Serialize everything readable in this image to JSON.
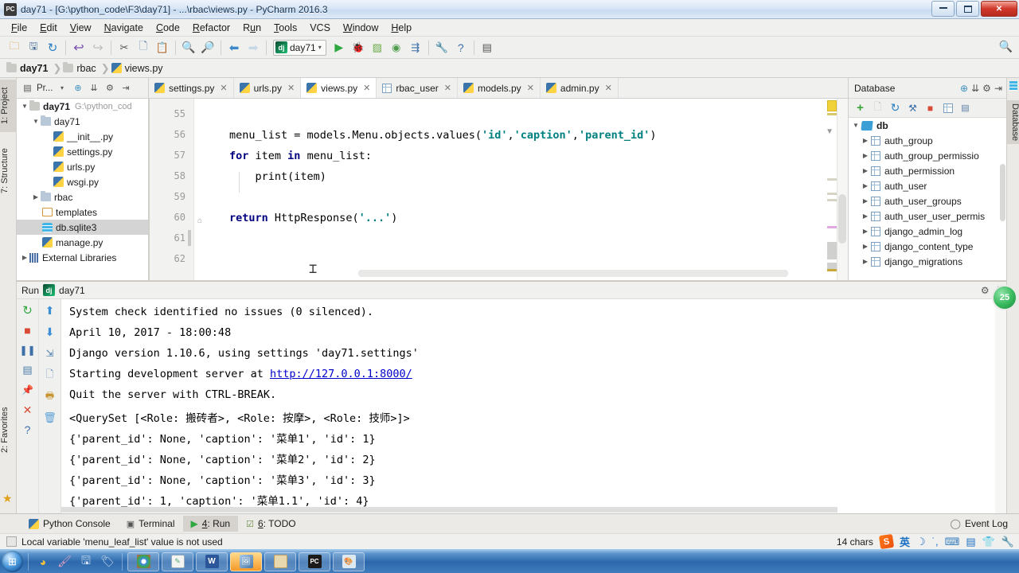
{
  "window": {
    "title": "day71 - [G:\\python_code\\F3\\day71] - ...\\rbac\\views.py - PyCharm 2016.3",
    "app_icon": "pycharm-icon",
    "minimize": "minimize-icon",
    "maximize": "restore-icon",
    "close": "✕"
  },
  "menubar": [
    {
      "label": "File"
    },
    {
      "label": "Edit"
    },
    {
      "label": "View"
    },
    {
      "label": "Navigate"
    },
    {
      "label": "Code"
    },
    {
      "label": "Refactor"
    },
    {
      "label": "Run"
    },
    {
      "label": "Tools"
    },
    {
      "label": "VCS"
    },
    {
      "label": "Window"
    },
    {
      "label": "Help"
    }
  ],
  "toolbar": {
    "buttons": [
      {
        "name": "open-folder-icon",
        "glyph": "🗀"
      },
      {
        "name": "save-all-icon",
        "glyph": "🖫"
      },
      {
        "name": "sync-icon",
        "glyph": "↻"
      },
      {
        "name": "undo-icon",
        "glyph": "↩"
      },
      {
        "name": "redo-icon",
        "glyph": "↪"
      },
      {
        "name": "cut-icon",
        "glyph": "✂"
      },
      {
        "name": "copy-icon",
        "glyph": "🗋"
      },
      {
        "name": "paste-icon",
        "glyph": "📋"
      },
      {
        "name": "find-icon",
        "glyph": "🔍"
      },
      {
        "name": "replace-icon",
        "glyph": "🔎"
      },
      {
        "name": "back-icon",
        "glyph": "⬅"
      },
      {
        "name": "forward-icon",
        "glyph": "➡"
      }
    ],
    "run_config": {
      "label": "day71",
      "icon": "django-icon",
      "caret": "▾"
    },
    "run_buttons": [
      {
        "name": "run-icon",
        "glyph": "▶"
      },
      {
        "name": "debug-icon",
        "glyph": "🐞"
      },
      {
        "name": "coverage-icon",
        "glyph": "▨"
      },
      {
        "name": "profile-icon",
        "glyph": "◉"
      },
      {
        "name": "run-with-console-icon",
        "glyph": "⇶"
      },
      {
        "name": "settings-wrench-icon",
        "glyph": "🔧"
      },
      {
        "name": "help-icon",
        "glyph": "?"
      },
      {
        "name": "update-app-icon",
        "glyph": "▤"
      }
    ],
    "search_icon": "search-icon"
  },
  "breadcrumb": [
    {
      "label": "day71",
      "icon": "folder-icon",
      "bold": true
    },
    {
      "label": "rbac",
      "icon": "folder-icon",
      "bold": false
    },
    {
      "label": "views.py",
      "icon": "python-file-icon",
      "bold": false
    }
  ],
  "left_strip": [
    {
      "label": "1: Project",
      "selected": true
    },
    {
      "label": "7: Structure",
      "selected": false
    }
  ],
  "favorites_tab": {
    "label": "2: Favorites",
    "icon": "star-icon"
  },
  "project_panel": {
    "title": "Pr...",
    "toolbar_icons": [
      "target-icon",
      "collapse-all-icon",
      "gear-icon",
      "hide-icon"
    ],
    "tree": [
      {
        "depth": 0,
        "arrow": "▼",
        "label": "day71",
        "path": "G:\\python_cod",
        "icon": "folder-icon",
        "bold": true,
        "selected": false
      },
      {
        "depth": 1,
        "arrow": "▼",
        "label": "day71",
        "path": "",
        "icon": "module-icon",
        "bold": false,
        "selected": false
      },
      {
        "depth": 2,
        "arrow": "",
        "label": "__init__.py",
        "path": "",
        "icon": "python-file-icon",
        "bold": false,
        "selected": false
      },
      {
        "depth": 2,
        "arrow": "",
        "label": "settings.py",
        "path": "",
        "icon": "python-file-icon",
        "bold": false,
        "selected": false
      },
      {
        "depth": 2,
        "arrow": "",
        "label": "urls.py",
        "path": "",
        "icon": "python-file-icon",
        "bold": false,
        "selected": false
      },
      {
        "depth": 2,
        "arrow": "",
        "label": "wsgi.py",
        "path": "",
        "icon": "python-file-icon",
        "bold": false,
        "selected": false
      },
      {
        "depth": 1,
        "arrow": "▶",
        "label": "rbac",
        "path": "",
        "icon": "module-icon",
        "bold": false,
        "selected": false
      },
      {
        "depth": 1,
        "arrow": "",
        "label": "templates",
        "path": "",
        "icon": "templates-folder-icon",
        "bold": false,
        "selected": false
      },
      {
        "depth": 1,
        "arrow": "",
        "label": "db.sqlite3",
        "path": "",
        "icon": "database-file-icon",
        "bold": false,
        "selected": true
      },
      {
        "depth": 1,
        "arrow": "",
        "label": "manage.py",
        "path": "",
        "icon": "python-file-icon",
        "bold": false,
        "selected": false
      },
      {
        "depth": 0,
        "arrow": "▶",
        "label": "External Libraries",
        "path": "",
        "icon": "library-icon",
        "bold": false,
        "selected": false
      }
    ]
  },
  "editor_tabs": [
    {
      "label": "settings.py",
      "icon": "python-file-icon",
      "active": false,
      "close": "✕"
    },
    {
      "label": "urls.py",
      "icon": "python-file-icon",
      "active": false,
      "close": "✕"
    },
    {
      "label": "views.py",
      "icon": "python-file-icon",
      "active": true,
      "close": "✕"
    },
    {
      "label": "rbac_user",
      "icon": "table-icon",
      "active": false,
      "close": "✕"
    },
    {
      "label": "models.py",
      "icon": "python-file-icon",
      "active": false,
      "close": "✕"
    },
    {
      "label": "admin.py",
      "icon": "python-file-icon",
      "active": false,
      "close": "✕"
    }
  ],
  "editor": {
    "line_numbers": [
      "55",
      "56",
      "57",
      "58",
      "59",
      "60",
      "61",
      "62"
    ],
    "lines": [
      {
        "num": "56",
        "tokens": [
          {
            "t": "menu_list = models.Menu.objects.values(",
            "c": "plain"
          },
          {
            "t": "'id'",
            "c": "str"
          },
          {
            "t": ",",
            "c": "plain"
          },
          {
            "t": "'caption'",
            "c": "str"
          },
          {
            "t": ",",
            "c": "plain"
          },
          {
            "t": "'parent_id'",
            "c": "str"
          },
          {
            "t": ")",
            "c": "plain"
          }
        ]
      },
      {
        "num": "57",
        "tokens": [
          {
            "t": "for",
            "c": "kw"
          },
          {
            "t": " item ",
            "c": "plain"
          },
          {
            "t": "in",
            "c": "kw"
          },
          {
            "t": " menu_list:",
            "c": "plain"
          }
        ]
      },
      {
        "num": "58",
        "tokens": [
          {
            "t": "    print(item)",
            "c": "plain"
          }
        ]
      },
      {
        "num": "60",
        "tokens": [
          {
            "t": "return",
            "c": "kw"
          },
          {
            "t": " HttpResponse(",
            "c": "plain"
          },
          {
            "t": "'...'",
            "c": "str"
          },
          {
            "t": ")",
            "c": "plain"
          }
        ]
      }
    ]
  },
  "database_panel": {
    "title": "Database",
    "header_icons": [
      "target-icon",
      "collapse-all-icon",
      "gear-icon",
      "hide-icon"
    ],
    "toolbar_icons": [
      "add-icon",
      "copy-icon",
      "refresh-icon",
      "data-source-icon",
      "stop-icon",
      "table-icon",
      "console-icon"
    ],
    "side_tab": "Database",
    "tree": [
      {
        "depth": 0,
        "arrow": "▼",
        "label": "db",
        "icon": "db-icon",
        "bold": true
      },
      {
        "depth": 1,
        "arrow": "▶",
        "label": "auth_group",
        "icon": "table-icon",
        "bold": false
      },
      {
        "depth": 1,
        "arrow": "▶",
        "label": "auth_group_permissio",
        "icon": "table-icon",
        "bold": false
      },
      {
        "depth": 1,
        "arrow": "▶",
        "label": "auth_permission",
        "icon": "table-icon",
        "bold": false
      },
      {
        "depth": 1,
        "arrow": "▶",
        "label": "auth_user",
        "icon": "table-icon",
        "bold": false
      },
      {
        "depth": 1,
        "arrow": "▶",
        "label": "auth_user_groups",
        "icon": "table-icon",
        "bold": false
      },
      {
        "depth": 1,
        "arrow": "▶",
        "label": "auth_user_user_permis",
        "icon": "table-icon",
        "bold": false
      },
      {
        "depth": 1,
        "arrow": "▶",
        "label": "django_admin_log",
        "icon": "table-icon",
        "bold": false
      },
      {
        "depth": 1,
        "arrow": "▶",
        "label": "django_content_type",
        "icon": "table-icon",
        "bold": false
      },
      {
        "depth": 1,
        "arrow": "▶",
        "label": "django_migrations",
        "icon": "table-icon",
        "bold": false
      }
    ]
  },
  "run_window": {
    "title": "Run",
    "config_name": "day71",
    "config_icon": "django-icon",
    "header_actions": [
      "gear-icon",
      "hide-icon"
    ],
    "left_tools": [
      {
        "name": "rerun-icon",
        "glyph": "↻"
      },
      {
        "name": "stop-icon",
        "glyph": "■"
      },
      {
        "name": "pause-icon",
        "glyph": "❚❚"
      },
      {
        "name": "show-console-icon",
        "glyph": "▤"
      },
      {
        "name": "pin-icon",
        "glyph": "📌"
      },
      {
        "name": "close-icon",
        "glyph": "✕"
      },
      {
        "name": "help-icon",
        "glyph": "?"
      }
    ],
    "right_tools": [
      {
        "name": "scroll-up-icon",
        "glyph": "⬆"
      },
      {
        "name": "scroll-down-icon",
        "glyph": "⬇"
      },
      {
        "name": "soft-wrap-icon",
        "glyph": "⇲"
      },
      {
        "name": "export-icon",
        "glyph": "🗋"
      },
      {
        "name": "print-icon",
        "glyph": "🖶"
      },
      {
        "name": "clear-all-icon",
        "glyph": "🗑"
      }
    ],
    "console_lines": [
      {
        "segments": [
          {
            "t": "System check identified no issues (0 silenced).",
            "c": "plain"
          }
        ]
      },
      {
        "segments": [
          {
            "t": "April 10, 2017 - 18:00:48",
            "c": "plain"
          }
        ]
      },
      {
        "segments": [
          {
            "t": "Django version 1.10.6, using settings 'day71.settings'",
            "c": "plain"
          }
        ]
      },
      {
        "segments": [
          {
            "t": "Starting development server at ",
            "c": "plain"
          },
          {
            "t": "http://127.0.0.1:8000/",
            "c": "link"
          }
        ]
      },
      {
        "segments": [
          {
            "t": "Quit the server with CTRL-BREAK.",
            "c": "plain"
          }
        ]
      },
      {
        "segments": [
          {
            "t": "<QuerySet [<Role: 搬砖者>, <Role: 按摩>, <Role: 技师>]>",
            "c": "plain"
          }
        ]
      },
      {
        "segments": [
          {
            "t": "{'parent_id': None, 'caption': '菜单1', 'id': 1}",
            "c": "plain"
          }
        ]
      },
      {
        "segments": [
          {
            "t": "{'parent_id': None, 'caption': '菜单2', 'id': 2}",
            "c": "plain"
          }
        ]
      },
      {
        "segments": [
          {
            "t": "{'parent_id': None, 'caption': '菜单3', 'id': 3}",
            "c": "plain"
          }
        ]
      },
      {
        "segments": [
          {
            "t": "{'parent_id': 1, 'caption': '菜单1.1', 'id': 4}",
            "c": "plain"
          }
        ]
      }
    ]
  },
  "bottom_tabs": [
    {
      "label": "Python Console",
      "prefix": "",
      "icon": "python-console-icon",
      "selected": false
    },
    {
      "label": "Terminal",
      "prefix": "",
      "icon": "terminal-icon",
      "selected": false
    },
    {
      "label": ": Run",
      "prefix": "4",
      "icon": "run-icon",
      "selected": true
    },
    {
      "label": ": TODO",
      "prefix": "6",
      "icon": "todo-icon",
      "selected": false
    }
  ],
  "event_log": {
    "label": "Event Log",
    "icon": "balloon-icon"
  },
  "status_bar": {
    "message": "Local variable 'menu_leaf_list' value is not used",
    "icon": "inspection-icon",
    "chars": "14 chars",
    "tray": [
      {
        "name": "sogou-icon",
        "glyph": "S"
      },
      {
        "name": "ime-chinese-icon",
        "glyph": "英"
      },
      {
        "name": "ime-moon-icon",
        "glyph": "☽"
      },
      {
        "name": "ime-punct-icon",
        "glyph": ", "
      },
      {
        "name": "keyboard-icon",
        "glyph": "⌨"
      },
      {
        "name": "ime-box-icon",
        "glyph": "🄰"
      },
      {
        "name": "skin-icon",
        "glyph": "👕"
      },
      {
        "name": "tools-icon",
        "glyph": "🔧"
      }
    ]
  },
  "floating_badge": {
    "label": "25"
  },
  "taskbar": {
    "start": "start-orb-icon",
    "quick_launch": [
      {
        "name": "media-player-icon",
        "glyph": "◕"
      },
      {
        "name": "paint-icon",
        "glyph": "🖌"
      },
      {
        "name": "save-icon",
        "glyph": "🖫"
      },
      {
        "name": "pinned-app-icon",
        "glyph": "🏷"
      }
    ],
    "tasks": [
      {
        "name": "taskbar-chrome",
        "glyph": "◉",
        "active": false
      },
      {
        "name": "taskbar-notepad",
        "glyph": "📝",
        "active": false
      },
      {
        "name": "taskbar-word",
        "glyph": "W",
        "active": false
      },
      {
        "name": "taskbar-image-viewer",
        "glyph": "🖼",
        "active": true
      },
      {
        "name": "taskbar-explorer",
        "glyph": "🗀",
        "active": false
      },
      {
        "name": "taskbar-pycharm",
        "glyph": "PC",
        "active": false
      },
      {
        "name": "taskbar-misc",
        "glyph": "🎨",
        "active": false
      }
    ]
  }
}
